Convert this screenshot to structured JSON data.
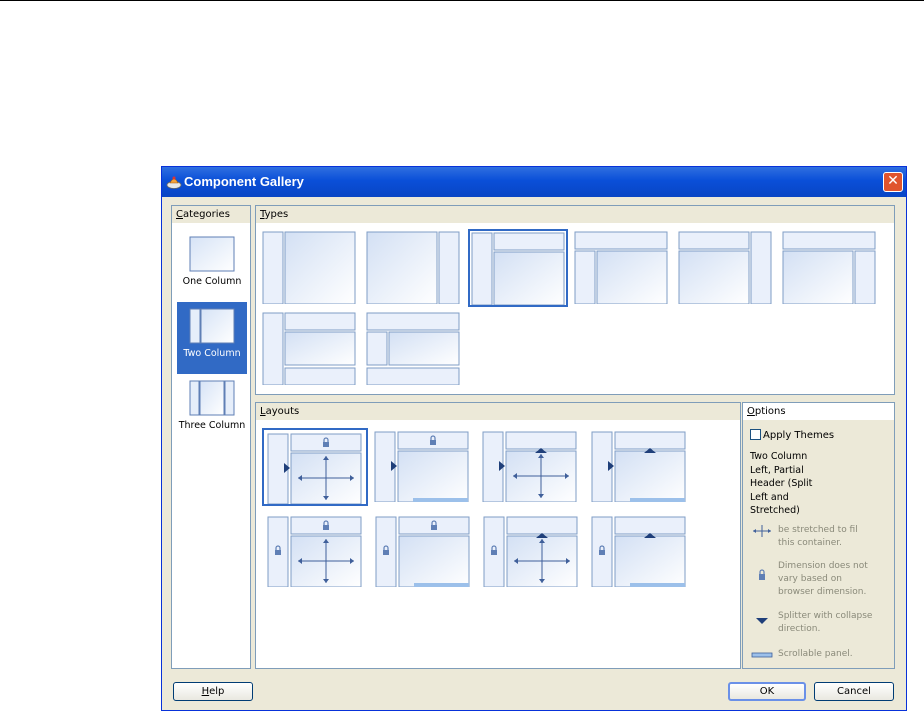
{
  "window": {
    "title": "Component Gallery",
    "close_label": "✕"
  },
  "categories": {
    "header_letter": "C",
    "header_rest": "ategories",
    "items": [
      {
        "label": "One Column",
        "icon": "one-column-icon",
        "selected": false
      },
      {
        "label": "Two Column",
        "icon": "two-column-icon",
        "selected": true
      },
      {
        "label": "Three Column",
        "icon": "three-column-icon",
        "selected": false
      }
    ]
  },
  "types": {
    "header_letter": "T",
    "header_rest": "ypes",
    "items": [
      {
        "icon": "left-column-main-icon",
        "selected": false
      },
      {
        "icon": "main-right-column-icon",
        "selected": false
      },
      {
        "icon": "left-column-header-main-icon",
        "selected": true
      },
      {
        "icon": "header-left-column-main-icon",
        "selected": false
      },
      {
        "icon": "header-main-right-column-icon",
        "selected": false
      },
      {
        "icon": "header-main-right-stacked-icon",
        "selected": false
      },
      {
        "icon": "left-column-header-main-footer-icon",
        "selected": false
      },
      {
        "icon": "header-left-main-footer-icon",
        "selected": false
      }
    ]
  },
  "layouts": {
    "header_letter": "L",
    "header_rest": "ayouts",
    "items": [
      {
        "icon": "layout-split-locked-stretched-icon",
        "selected": true
      },
      {
        "icon": "layout-split-locked-scroll-icon",
        "selected": false
      },
      {
        "icon": "layout-split-split-stretched-icon",
        "selected": false
      },
      {
        "icon": "layout-split-split-scroll-icon",
        "selected": false
      },
      {
        "icon": "layout-locked-locked-stretched-icon",
        "selected": false
      },
      {
        "icon": "layout-locked-locked-scroll-icon",
        "selected": false
      },
      {
        "icon": "layout-locked-split-stretched-icon",
        "selected": false
      },
      {
        "icon": "layout-locked-split-scroll-icon",
        "selected": false
      }
    ]
  },
  "options": {
    "header_letter": "O",
    "header_rest": "ptions",
    "apply_themes_label": "Apply Themes",
    "apply_themes_checked": false,
    "description": [
      "Two Column",
      "Left, Partial",
      "Header (Split",
      "Left and",
      "Stretched)"
    ],
    "legend": [
      {
        "icon": "stretch-arrows-icon",
        "text": [
          "be stretched to fil",
          "this container."
        ]
      },
      {
        "icon": "lock-icon",
        "text": [
          "Dimension does not",
          "vary based on",
          "browser dimension."
        ]
      },
      {
        "icon": "splitter-arrow-icon",
        "text": [
          "Splitter with collapse",
          "direction."
        ]
      },
      {
        "icon": "scroll-bar-icon",
        "text": [
          "Scrollable panel."
        ]
      }
    ]
  },
  "buttons": {
    "help_letter": "H",
    "help_rest": "elp",
    "ok": "OK",
    "cancel": "Cancel"
  },
  "colors": {
    "title_bar": "#0a4fd8",
    "selection": "#316ac5",
    "dialog_bg": "#ece9d8",
    "thumb_stroke": "#7f9dc6"
  }
}
